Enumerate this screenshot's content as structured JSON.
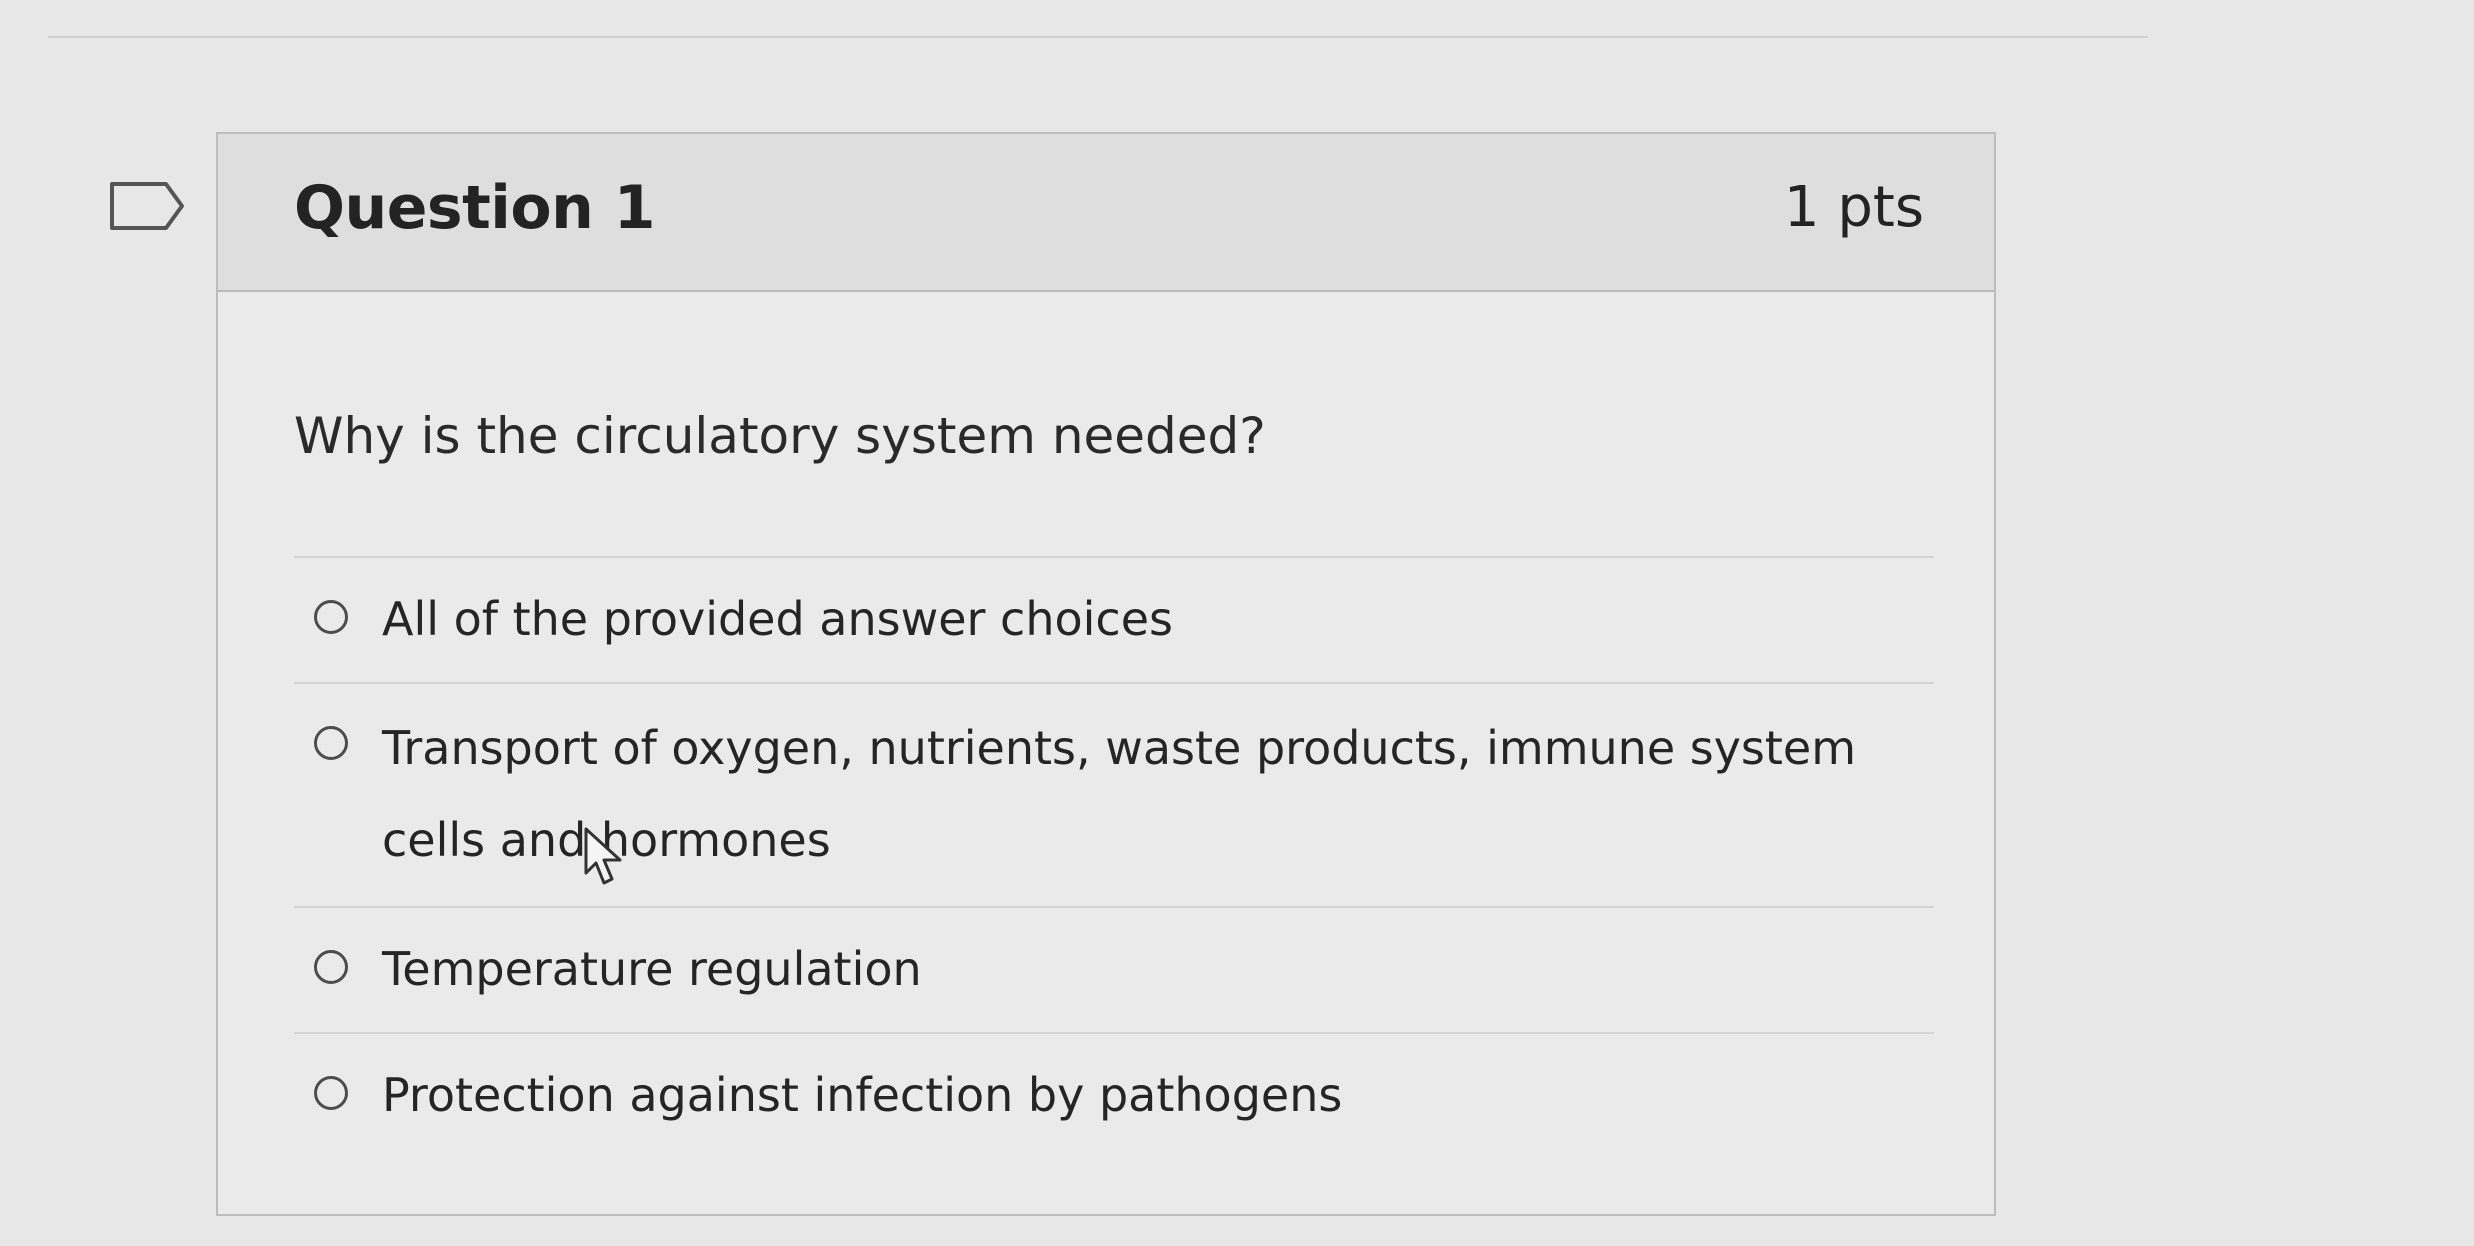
{
  "question": {
    "title": "Question 1",
    "points": "1 pts",
    "prompt": "Why is the circulatory system needed?",
    "answers": [
      {
        "label": "All of the provided answer choices"
      },
      {
        "label": "Transport of oxygen, nutrients, waste products, immune system cells and hormones"
      },
      {
        "label": "Temperature regulation"
      },
      {
        "label": "Protection against infection by pathogens"
      }
    ]
  },
  "icons": {
    "flag": "flag-bookmark-icon",
    "radio": "radio-button-icon",
    "cursor": "mouse-pointer-icon"
  }
}
